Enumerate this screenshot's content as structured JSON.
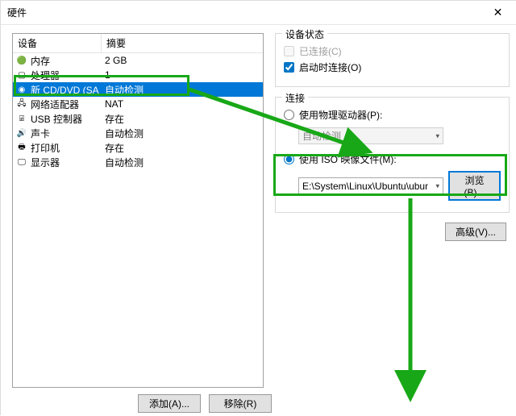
{
  "window": {
    "close_glyph": "✕"
  },
  "tab_name": "硬件",
  "list": {
    "head": {
      "c1": "设备",
      "c2": "摘要"
    },
    "rows": [
      {
        "icon": "memory-icon",
        "glyph": "🟢",
        "name": "内存",
        "summary": "2 GB",
        "selected": false
      },
      {
        "icon": "cpu-icon",
        "glyph": "▢",
        "name": "处理器",
        "summary": "1",
        "selected": false
      },
      {
        "icon": "disc-icon",
        "glyph": "◉",
        "name": "新 CD/DVD (SA",
        "summary": "自动检测",
        "selected": true
      },
      {
        "icon": "nic-icon",
        "glyph": "🖧",
        "name": "网络适配器",
        "summary": "NAT",
        "selected": false
      },
      {
        "icon": "usb-icon",
        "glyph": "⍯",
        "name": "USB 控制器",
        "summary": "存在",
        "selected": false
      },
      {
        "icon": "sound-icon",
        "glyph": "🔊",
        "name": "声卡",
        "summary": "自动检测",
        "selected": false
      },
      {
        "icon": "printer-icon",
        "glyph": "🖶",
        "name": "打印机",
        "summary": "存在",
        "selected": false
      },
      {
        "icon": "display-icon",
        "glyph": "🖵",
        "name": "显示器",
        "summary": "自动检测",
        "selected": false
      }
    ]
  },
  "status": {
    "legend": "设备状态",
    "connected": "已连接(C)",
    "connect_power": "启动时连接(O)"
  },
  "connection": {
    "legend": "连接",
    "physical": "使用物理驱动器(P):",
    "physical_value": "自动检测",
    "iso": "使用 ISO 映像文件(M):",
    "iso_path": "E:\\System\\Linux\\Ubuntu\\ubun",
    "browse": "浏览(B)..."
  },
  "advanced_btn": "高级(V)...",
  "footer": {
    "add": "添加(A)...",
    "remove": "移除(R)"
  }
}
